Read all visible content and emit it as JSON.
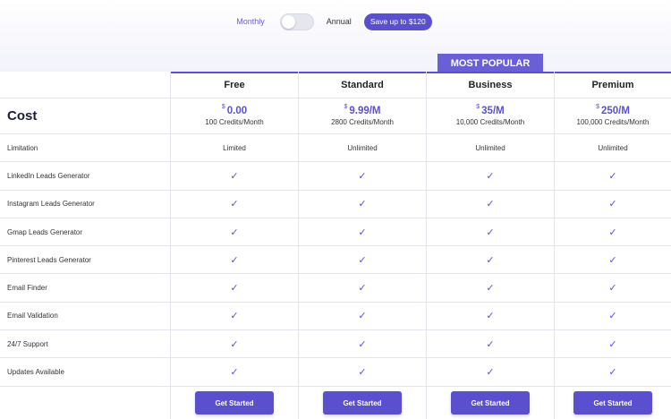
{
  "billing": {
    "monthly_label": "Monthly",
    "annual_label": "Annual",
    "save_badge": "Save up to $120",
    "annual_selected": false
  },
  "popular_badge": "MOST POPULAR",
  "cost_label": "Cost",
  "plans": [
    {
      "name": "Free",
      "currency": "$",
      "price": "0.00",
      "credits": "100 Credits/Month",
      "cta": "Get Started"
    },
    {
      "name": "Standard",
      "currency": "$",
      "price": "9.99/M",
      "credits": "2800 Credits/Month",
      "cta": "Get Started"
    },
    {
      "name": "Business",
      "currency": "$",
      "price": "35/M",
      "credits": "10,000 Credits/Month",
      "cta": "Get Started"
    },
    {
      "name": "Premium",
      "currency": "$",
      "price": "250/M",
      "credits": "100,000 Credits/Month",
      "cta": "Get Started"
    }
  ],
  "features": [
    {
      "label": "Limitation",
      "values": [
        "Limited",
        "Unlimited",
        "Unlimited",
        "Unlimited"
      ]
    },
    {
      "label": "LinkedIn Leads Generator",
      "values": [
        "✓",
        "✓",
        "✓",
        "✓"
      ]
    },
    {
      "label": "Instagram Leads Generator",
      "values": [
        "✓",
        "✓",
        "✓",
        "✓"
      ]
    },
    {
      "label": "Gmap Leads Generator",
      "values": [
        "✓",
        "✓",
        "✓",
        "✓"
      ]
    },
    {
      "label": "Pinterest Leads Generator",
      "values": [
        "✓",
        "✓",
        "✓",
        "✓"
      ]
    },
    {
      "label": "Email Finder",
      "values": [
        "✓",
        "✓",
        "✓",
        "✓"
      ]
    },
    {
      "label": "Email Validation",
      "values": [
        "✓",
        "✓",
        "✓",
        "✓"
      ]
    },
    {
      "label": "24/7 Support",
      "values": [
        "✓",
        "✓",
        "✓",
        "✓"
      ]
    },
    {
      "label": "Updates Available",
      "values": [
        "✓",
        "✓",
        "✓",
        "✓"
      ]
    }
  ],
  "colors": {
    "accent": "#5b4fd0",
    "popular": "#6b5fd6",
    "border": "#e4e4ec"
  }
}
